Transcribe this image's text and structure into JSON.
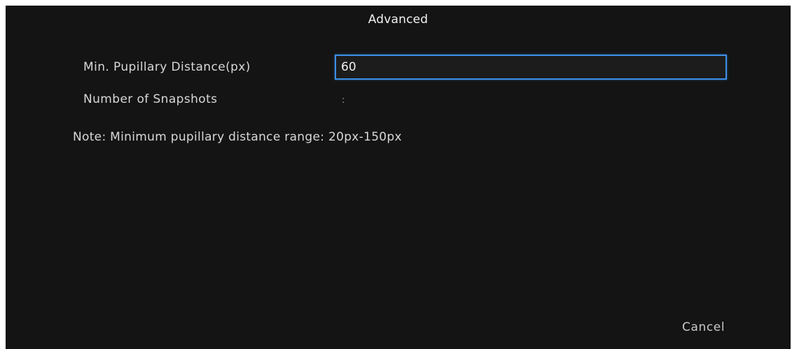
{
  "dialog": {
    "title": "Advanced",
    "fields": {
      "pupillary": {
        "label": "Min. Pupillary Distance(px)",
        "value": "60"
      },
      "snapshots": {
        "label": "Number of Snapshots",
        "value": ":"
      }
    },
    "note": "Note: Minimum pupillary distance range: 20px-150px",
    "cancel_label": "Cancel"
  },
  "colors": {
    "background": "#141414",
    "input_border": "#3d8fe8",
    "text": "#d8d8d8"
  }
}
